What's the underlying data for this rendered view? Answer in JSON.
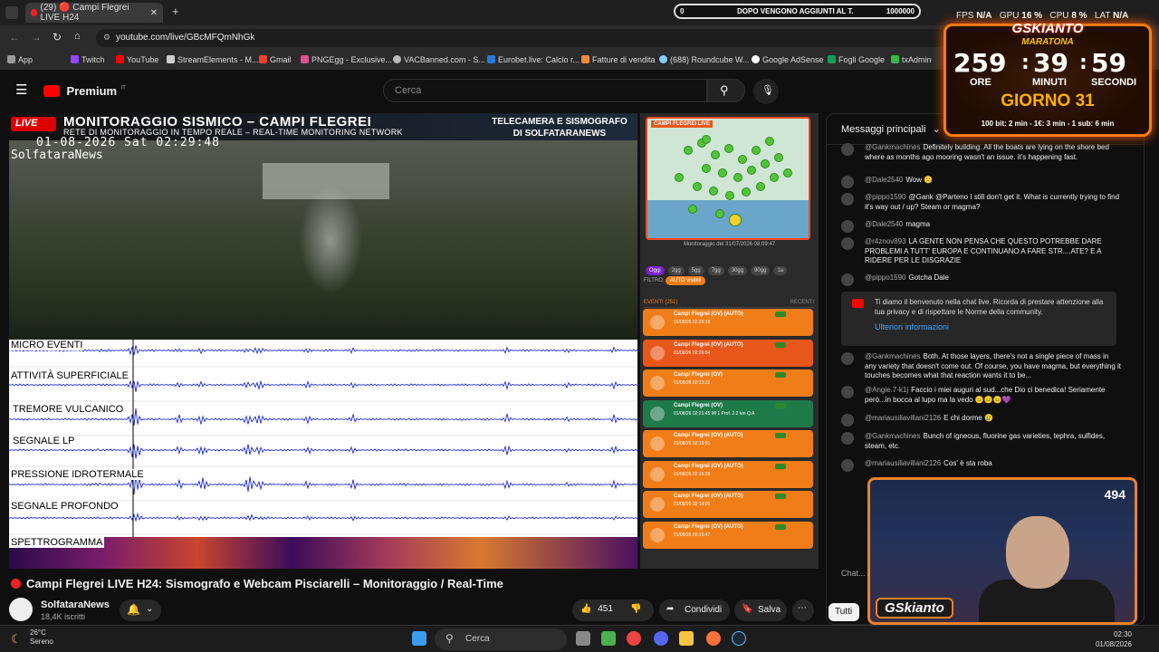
{
  "browser": {
    "tab_title": "(29) 🔴 Campi Flegrei LIVE H24",
    "url": "youtube.com/live/GBcMFQmNhGk",
    "bookmarks": [
      "App",
      "Twitch",
      "YouTube",
      "StreamElements - M...",
      "Gmail",
      "PNGEgg - Exclusive...",
      "VACBanned.com - S...",
      "Eurobet.live: Calcio r...",
      "Fatture di vendita",
      "(688) Roundcube W...",
      "Google AdSense",
      "Fogli Google",
      "txAdmin"
    ]
  },
  "youtube": {
    "logo_text": "Premium",
    "logo_sup": "IT",
    "search_placeholder": "Cerca"
  },
  "stream_overlay": {
    "goal_left": "0",
    "goal_text": "DOPO VENGONO AGGIUNTI AL T.",
    "goal_right": "1000000",
    "stats": {
      "fps_label": "FPS",
      "fps": "N/A",
      "gpu_label": "GPU",
      "gpu": "16 %",
      "cpu_label": "CPU",
      "cpu": "8 %",
      "lat_label": "LAT",
      "lat": "N/A"
    },
    "timer": {
      "title": "GSKIANTO",
      "subtitle": "MARATONA",
      "hours": "259",
      "minutes": "39",
      "seconds": "59",
      "hours_label": "ORE",
      "minutes_label": "MINUTI",
      "seconds_label": "SECONDI",
      "day": "GIORNO 31",
      "footer": "100 bit: 2 min - 1€: 3 min - 1 sub: 6 min"
    },
    "viewers": "494",
    "webcam_logo": "GSkianto"
  },
  "video": {
    "live_badge": "LIVE",
    "banner_title": "MONITORAGGIO SISMICO – CAMPI FLEGREI",
    "banner_sub": "RETE DI MONITORAGGIO IN TEMPO REALE – REAL-TIME MONITORING NETWORK",
    "banner_right_1": "TELECAMERA E SISMOGRAFO",
    "banner_right_2": "DI SOLFATARANEWS",
    "timestamp": "01-08-2026 Sat 02:29:48",
    "watermark": "SolfataraNews",
    "seismo_labels": [
      "MICRO EVENTI",
      "ATTIVITÀ SUPERFICIALE",
      "TREMORE VULCANICO",
      "SEGNALE LP",
      "PRESSIONE IDROTERMALE",
      "SEGNALE PROFONDO"
    ],
    "spectrogram_label": "SPETTROGRAMMA",
    "map_title": "CAMPI FLEGREI LIVE",
    "map_caption": "Monitoraggio del 31/07/2026 08:09:47",
    "filters": [
      "Oggi",
      "2gg",
      "5gg",
      "7gg",
      "30gg",
      "90gg",
      "1a"
    ],
    "filter_label": "FILTRO:",
    "auto_label": "AUTO visibili",
    "events_header": "EVENTI (251)",
    "events_recent": "RECENTI",
    "events": [
      {
        "title": "Campi Flegrei (OV) (AUTO)",
        "detail": "01/08/26 02:26:16",
        "color": "#f07d18"
      },
      {
        "title": "Campi Flegrei (OV) (AUTO)",
        "detail": "01/08/26 02:26:54",
        "color": "#e8561a"
      },
      {
        "title": "Campi Flegrei (OV)",
        "detail": "01/08/26 02:23:22",
        "color": "#f07d18"
      },
      {
        "title": "Campi Flegrei (OV)",
        "detail": "01/08/26 02:21:45  Ml 1  Prof. 2.2 km Q:A",
        "color": "#1f7a4a"
      },
      {
        "title": "Campi Flegrei (OV) (AUTO)",
        "detail": "01/08/26 02:19:51",
        "color": "#f07d18"
      },
      {
        "title": "Campi Flegrei (OV) (AUTO)",
        "detail": "01/08/26 02:15:39",
        "color": "#f07d18"
      },
      {
        "title": "Campi Flegrei (OV) (AUTO)",
        "detail": "01/08/26 02:14:09",
        "color": "#f07d18"
      },
      {
        "title": "Campi Flegrei (OV) (AUTO)",
        "detail": "01/08/26 02:10:47",
        "color": "#f07d18"
      }
    ]
  },
  "video_info": {
    "title": "Campi Flegrei LIVE H24: Sismografo e Webcam Pisciarelli – Monitoraggio / Real-Time",
    "channel": "SolfataraNews",
    "subscribers": "18,4K iscritti",
    "likes": "451",
    "share": "Condividi",
    "save": "Salva"
  },
  "chat": {
    "header": "Messaggi principali",
    "messages": [
      {
        "author": "@Gankmachines",
        "text": "Definitely building. All the boats are lying on the shore bed where as months ago mooring wasn't an issue. it's happening fast."
      },
      {
        "author": "@Dale2540",
        "text": "Wow 🙁"
      },
      {
        "author": "@pippo1590",
        "text": "@Gank @Parteno I still don't get it. What is currently trying to find it's way out / up? Steam or magma?"
      },
      {
        "author": "@Dale2540",
        "text": "magma"
      },
      {
        "author": "@r4znov893",
        "text": "LA GENTE NON PENSA CHE QUESTO POTREBBE DARE PROBLEMI A TUTT' EUROPA E CONTINUANO A FARE STR....ATE? E A RIDERE PER LE DISGRAZIE"
      },
      {
        "author": "@pippo1590",
        "text": "Gotcha Dale"
      }
    ],
    "notice": "Ti diamo il benvenuto nella chat live. Ricorda di prestare attenzione alla tua privacy e di rispettare le Norme della community.",
    "notice_link": "Ulteriori informazioni",
    "messages2": [
      {
        "author": "@Gankmachines",
        "text": "Both. At those layers, there's not a single piece of mass in any variety that doesn't come out. Of course, you have magma, but everything it touches becomes what that reaction wants it to be..."
      },
      {
        "author": "@Angie.7-k1j",
        "text": "Faccio i miei auguri al sud...che Dio ci benedica! Seriamente però...in bocca al lupo ma la vedo 😐😐😐💜"
      },
      {
        "author": "@mariausiliavillani2126",
        "text": "E chi dorme 😢"
      },
      {
        "author": "@Gankmachines",
        "text": "Bunch of igneous, fluorine gas varieties, tephra, sulfides, steam, etc."
      },
      {
        "author": "@mariausiliavillani2126",
        "text": "Cos' è sta roba"
      }
    ],
    "input_placeholder": "Chat...",
    "filter_button": "Tutti"
  },
  "taskbar": {
    "temp": "26°C",
    "weather": "Sereno",
    "search": "Cerca",
    "time": "02:30",
    "date": "01/08/2026"
  }
}
